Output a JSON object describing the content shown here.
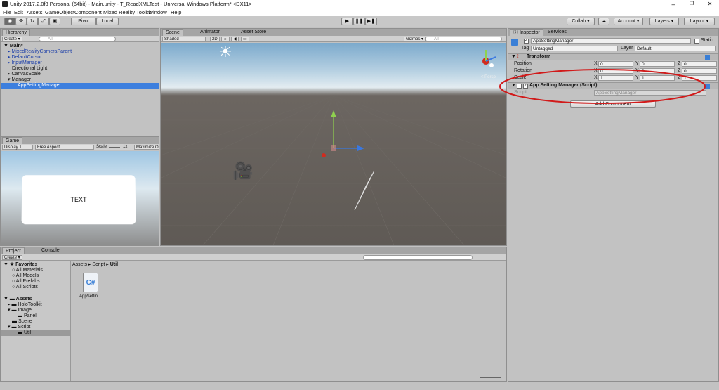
{
  "window": {
    "title": "Unity 2017.2.0f3 Personal (64bit) - Main.unity - T_ReadXMLTest - Universal Windows Platform* <DX11>",
    "min": "–",
    "max": "❐",
    "close": "✕"
  },
  "menu": [
    "File",
    "Edit",
    "Assets",
    "GameObject",
    "Component",
    "Mixed Reality Toolkit",
    "Window",
    "Help"
  ],
  "toolbar": {
    "pivot": "Pivot",
    "local": "Local",
    "collab": "Collab ▾",
    "account": "Account ▾",
    "layers": "Layers ▾",
    "layout": "Layout ▾",
    "cloud": "☁"
  },
  "hierarchy": {
    "tab": "Hierarchy",
    "create": "Create ▾",
    "search": "All",
    "scene": "Main*",
    "items": [
      {
        "label": "MixedRealityCameraParent"
      },
      {
        "label": "DefaultCursor"
      },
      {
        "label": "InputManager"
      },
      {
        "label": "Directional Light"
      },
      {
        "label": "CanvasScale"
      },
      {
        "label": "Manager"
      },
      {
        "label": "AppSettingManager"
      }
    ]
  },
  "scene": {
    "tabs": [
      "Scene",
      "Animator",
      "Asset Store"
    ],
    "shaded": "Shaded",
    "twod": "2D",
    "gizmos": "Gizmos ▾",
    "search": "All",
    "persp": "< Persp"
  },
  "game": {
    "tab": "Game",
    "display": "Display 1",
    "aspect": "Free Aspect",
    "scale": "Scale",
    "scale_val": "1x",
    "maximize": "Maximize O",
    "panel_text": "TEXT"
  },
  "inspector": {
    "tabs": [
      "Inspector",
      "Services"
    ],
    "object_name": "AppSettingManager",
    "static": "Static",
    "tag_label": "Tag",
    "tag_value": "Untagged",
    "layer_label": "Layer",
    "layer_value": "Default",
    "transform": {
      "title": "Transform",
      "position": "Position",
      "rotation": "Rotation",
      "scale": "Scale",
      "x": "X",
      "y": "Y",
      "z": "Z",
      "pos": [
        "0",
        "0",
        "0"
      ],
      "rot": [
        "0",
        "0",
        "0"
      ],
      "scl": [
        "1",
        "1",
        "1"
      ]
    },
    "script_comp": {
      "title": "App Setting Manager (Script)",
      "script_label": "Script",
      "script_value": "AppSettingManager"
    },
    "add_component": "Add Component"
  },
  "project": {
    "tabs": [
      "Project",
      "Console"
    ],
    "create": "Create ▾",
    "favorites": {
      "label": "Favorites",
      "items": [
        "All Materials",
        "All Models",
        "All Prefabs",
        "All Scripts"
      ]
    },
    "assets": {
      "label": "Assets",
      "items": [
        {
          "label": "HoloToolkit"
        },
        {
          "label": "Image"
        },
        {
          "label": "Panel"
        },
        {
          "label": "Scene"
        },
        {
          "label": "Script"
        },
        {
          "label": "Util"
        }
      ]
    },
    "breadcrumb": [
      "Assets",
      "Script",
      "Util"
    ],
    "file": {
      "name": "AppSettin...",
      "glyph": "C#"
    }
  },
  "colors": {
    "accent": "#3d7fde",
    "annotation": "#d11a1a"
  }
}
